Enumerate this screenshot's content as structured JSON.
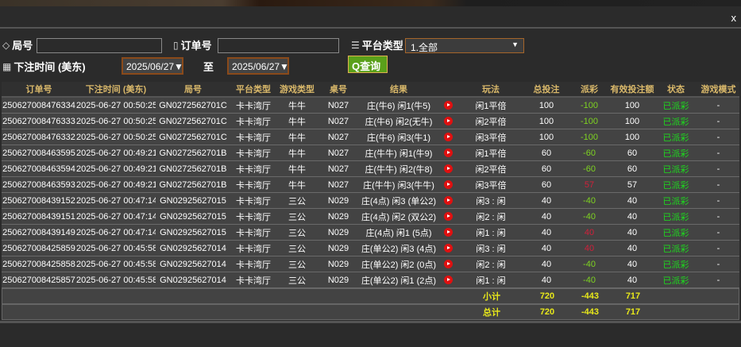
{
  "close_label": "x",
  "filters": {
    "round_label": "局号",
    "round_value": "",
    "order_label": "订单号",
    "order_value": "",
    "platform_label": "平台类型",
    "platform_value": "1.全部",
    "time_label": "下注时间 (美东)",
    "date_from": "2025/06/27▼",
    "to_label": "至",
    "date_to": "2025/06/27▼",
    "query_label": "查询"
  },
  "table": {
    "headers": [
      "订单号",
      "下注时间 (美东)",
      "局号",
      "平台类型",
      "游戏类型",
      "桌号",
      "结果",
      "",
      "玩法",
      "总投注",
      "派彩",
      "有效投注额",
      "状态",
      "游戏模式"
    ],
    "rows": [
      [
        "250627008476334",
        "2025-06-27 00:50:25",
        "GN0272562701C",
        "卡卡湾厅",
        "牛牛",
        "N027",
        "庄(牛6) 闲1(牛5)",
        "闲1平倍",
        "100",
        "-100",
        "100",
        "已派彩",
        "-"
      ],
      [
        "250627008476333",
        "2025-06-27 00:50:25",
        "GN0272562701C",
        "卡卡湾厅",
        "牛牛",
        "N027",
        "庄(牛6) 闲2(无牛)",
        "闲2平倍",
        "100",
        "-100",
        "100",
        "已派彩",
        "-"
      ],
      [
        "250627008476332",
        "2025-06-27 00:50:25",
        "GN0272562701C",
        "卡卡湾厅",
        "牛牛",
        "N027",
        "庄(牛6) 闲3(牛1)",
        "闲3平倍",
        "100",
        "-100",
        "100",
        "已派彩",
        "-"
      ],
      [
        "250627008463595",
        "2025-06-27 00:49:21",
        "GN0272562701B",
        "卡卡湾厅",
        "牛牛",
        "N027",
        "庄(牛牛) 闲1(牛9)",
        "闲1平倍",
        "60",
        "-60",
        "60",
        "已派彩",
        "-"
      ],
      [
        "250627008463594",
        "2025-06-27 00:49:21",
        "GN0272562701B",
        "卡卡湾厅",
        "牛牛",
        "N027",
        "庄(牛牛) 闲2(牛8)",
        "闲2平倍",
        "60",
        "-60",
        "60",
        "已派彩",
        "-"
      ],
      [
        "250627008463593",
        "2025-06-27 00:49:21",
        "GN0272562701B",
        "卡卡湾厅",
        "牛牛",
        "N027",
        "庄(牛牛) 闲3(牛牛)",
        "闲3平倍",
        "60",
        "57",
        "57",
        "已派彩",
        "-"
      ],
      [
        "250627008439152",
        "2025-06-27 00:47:14",
        "GN02925627015",
        "卡卡湾厅",
        "三公",
        "N029",
        "庄(4点) 闲3 (单公2)",
        "闲3 : 闲",
        "40",
        "-40",
        "40",
        "已派彩",
        "-"
      ],
      [
        "250627008439151",
        "2025-06-27 00:47:14",
        "GN02925627015",
        "卡卡湾厅",
        "三公",
        "N029",
        "庄(4点) 闲2 (双公2)",
        "闲2 : 闲",
        "40",
        "-40",
        "40",
        "已派彩",
        "-"
      ],
      [
        "250627008439149",
        "2025-06-27 00:47:14",
        "GN02925627015",
        "卡卡湾厅",
        "三公",
        "N029",
        "庄(4点) 闲1 (5点)",
        "闲1 : 闲",
        "40",
        "40",
        "40",
        "已派彩",
        "-"
      ],
      [
        "250627008425859",
        "2025-06-27 00:45:58",
        "GN02925627014",
        "卡卡湾厅",
        "三公",
        "N029",
        "庄(单公2) 闲3 (4点)",
        "闲3 : 闲",
        "40",
        "40",
        "40",
        "已派彩",
        "-"
      ],
      [
        "250627008425858",
        "2025-06-27 00:45:58",
        "GN02925627014",
        "卡卡湾厅",
        "三公",
        "N029",
        "庄(单公2) 闲2 (0点)",
        "闲2 : 闲",
        "40",
        "-40",
        "40",
        "已派彩",
        "-"
      ],
      [
        "250627008425857",
        "2025-06-27 00:45:58",
        "GN02925627014",
        "卡卡湾厅",
        "三公",
        "N029",
        "庄(单公2) 闲1 (2点)",
        "闲1 : 闲",
        "40",
        "-40",
        "40",
        "已派彩",
        "-"
      ]
    ],
    "subtotal": {
      "label": "小计",
      "total_bet": "720",
      "payout": "-443",
      "valid_bet": "717"
    },
    "total": {
      "label": "总计",
      "total_bet": "720",
      "payout": "-443",
      "valid_bet": "717"
    }
  },
  "colors": {
    "header_text": "#d9b86a",
    "negative": "#7ed321",
    "positive": "#d0203a",
    "status": "#1ed81e",
    "summary": "#e8e81a"
  }
}
